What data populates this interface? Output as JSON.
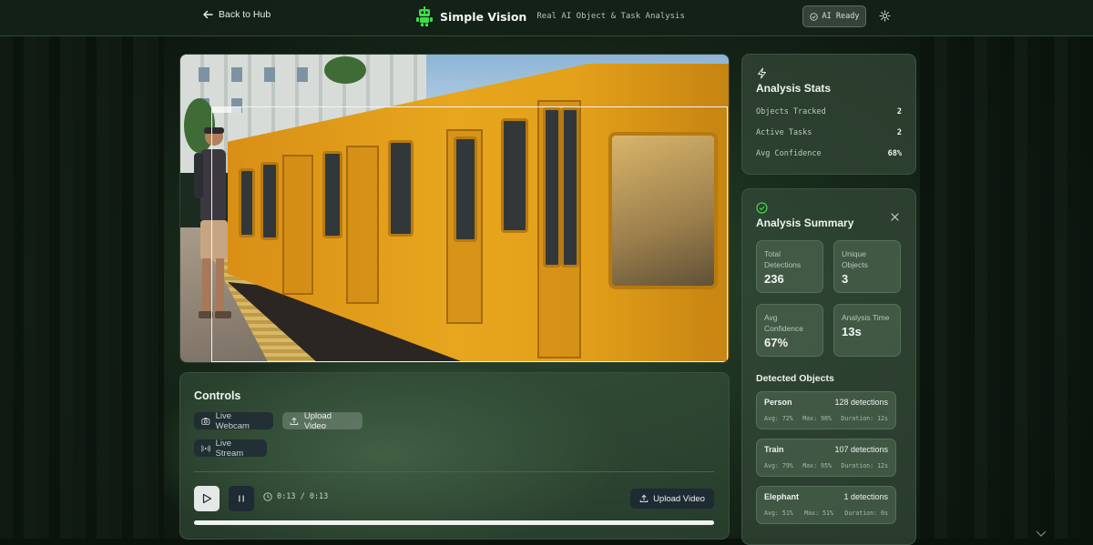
{
  "header": {
    "back_label": "Back to Hub",
    "brand_name": "Simple Vision",
    "brand_tagline": "Real AI Object & Task Analysis",
    "status_label": "AI Ready"
  },
  "controls": {
    "title": "Controls",
    "live_webcam": "Live Webcam",
    "upload_video": "Upload Video",
    "live_stream": "Live Stream",
    "time_readout": "0:13 / 0:13",
    "upload_video_2": "Upload Video",
    "progress": 1.0
  },
  "stats": {
    "title": "Analysis Stats",
    "rows": [
      {
        "label": "Objects Tracked",
        "value": "2"
      },
      {
        "label": "Active Tasks",
        "value": "2"
      },
      {
        "label": "Avg Confidence",
        "value": "68%"
      }
    ]
  },
  "summary": {
    "title": "Analysis Summary",
    "tiles": [
      {
        "label": "Total Detections",
        "value": "236"
      },
      {
        "label": "Unique Objects",
        "value": "3"
      },
      {
        "label": "Avg Confidence",
        "value": "67%"
      },
      {
        "label": "Analysis Time",
        "value": "13s"
      }
    ],
    "detected_title": "Detected Objects",
    "objects": [
      {
        "name": "Person",
        "count": "128 detections",
        "avg": "Avg: 72%",
        "max": "Max: 98%",
        "duration": "Duration: 12s"
      },
      {
        "name": "Train",
        "count": "107 detections",
        "avg": "Avg: 79%",
        "max": "Max: 95%",
        "duration": "Duration: 12s"
      },
      {
        "name": "Elephant",
        "count": "1 detections",
        "avg": "Avg: 51%",
        "max": "Max: 51%",
        "duration": "Duration: 0s"
      }
    ]
  },
  "colors": {
    "accent": "#3ddc4a",
    "panel": "#34493a"
  }
}
